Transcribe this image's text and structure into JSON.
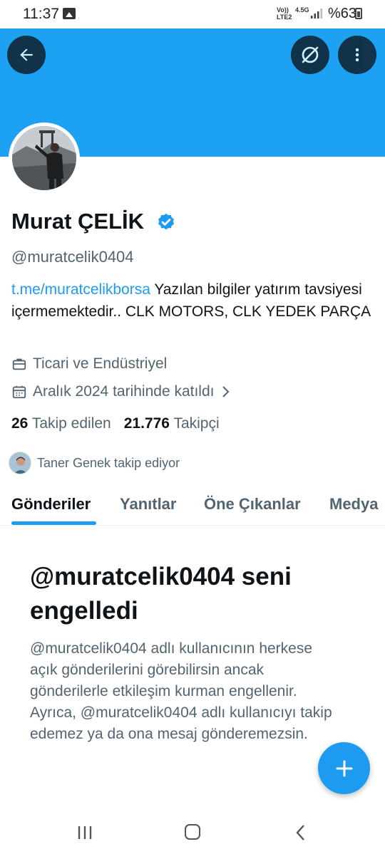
{
  "status_bar": {
    "time": "11:37",
    "network_top": "Vo))",
    "network_bottom": "LTE2",
    "network_type": "4.5G",
    "battery": "%63"
  },
  "header": {
    "banner_color": "#1da1f2",
    "back_icon": "arrow-left-icon",
    "grok_icon": "grok-icon",
    "more_icon": "more-vertical-icon"
  },
  "profile": {
    "name": "Murat ÇELİK",
    "handle": "@muratcelik0404",
    "bio_link": "t.me/muratcelikborsa",
    "bio_text": " Yazılan bilgiler yatırım tavsiyesi içermemektedir.. CLK MOTORS, CLK YEDEK PARÇA",
    "category": "Ticari ve Endüstriyel",
    "joined": "Aralık 2024 tarihinde katıldı",
    "following_count": "26",
    "following_label": "Takip edilen",
    "followers_count": "21.776",
    "followers_label": "Takipçi",
    "followed_by": "Taner Genek takip ediyor"
  },
  "tabs": [
    {
      "label": "Gönderiler",
      "active": true
    },
    {
      "label": "Yanıtlar",
      "active": false
    },
    {
      "label": "Öne Çıkanlar",
      "active": false
    },
    {
      "label": "Medya",
      "active": false
    }
  ],
  "blocked": {
    "title": "@muratcelik0404 seni engelledi",
    "body": "@muratcelik0404 adlı kullanıcının herkese açık gönderilerini görebilirsin ancak gönderilerle etkileşim kurman engellenir. Ayrıca, @muratcelik0404 adlı kullanıcıyı takip edemez ya da ona mesaj gönderemezsin."
  },
  "colors": {
    "accent": "#1d9bf0",
    "text_primary": "#0f1419",
    "text_secondary": "#536471"
  }
}
